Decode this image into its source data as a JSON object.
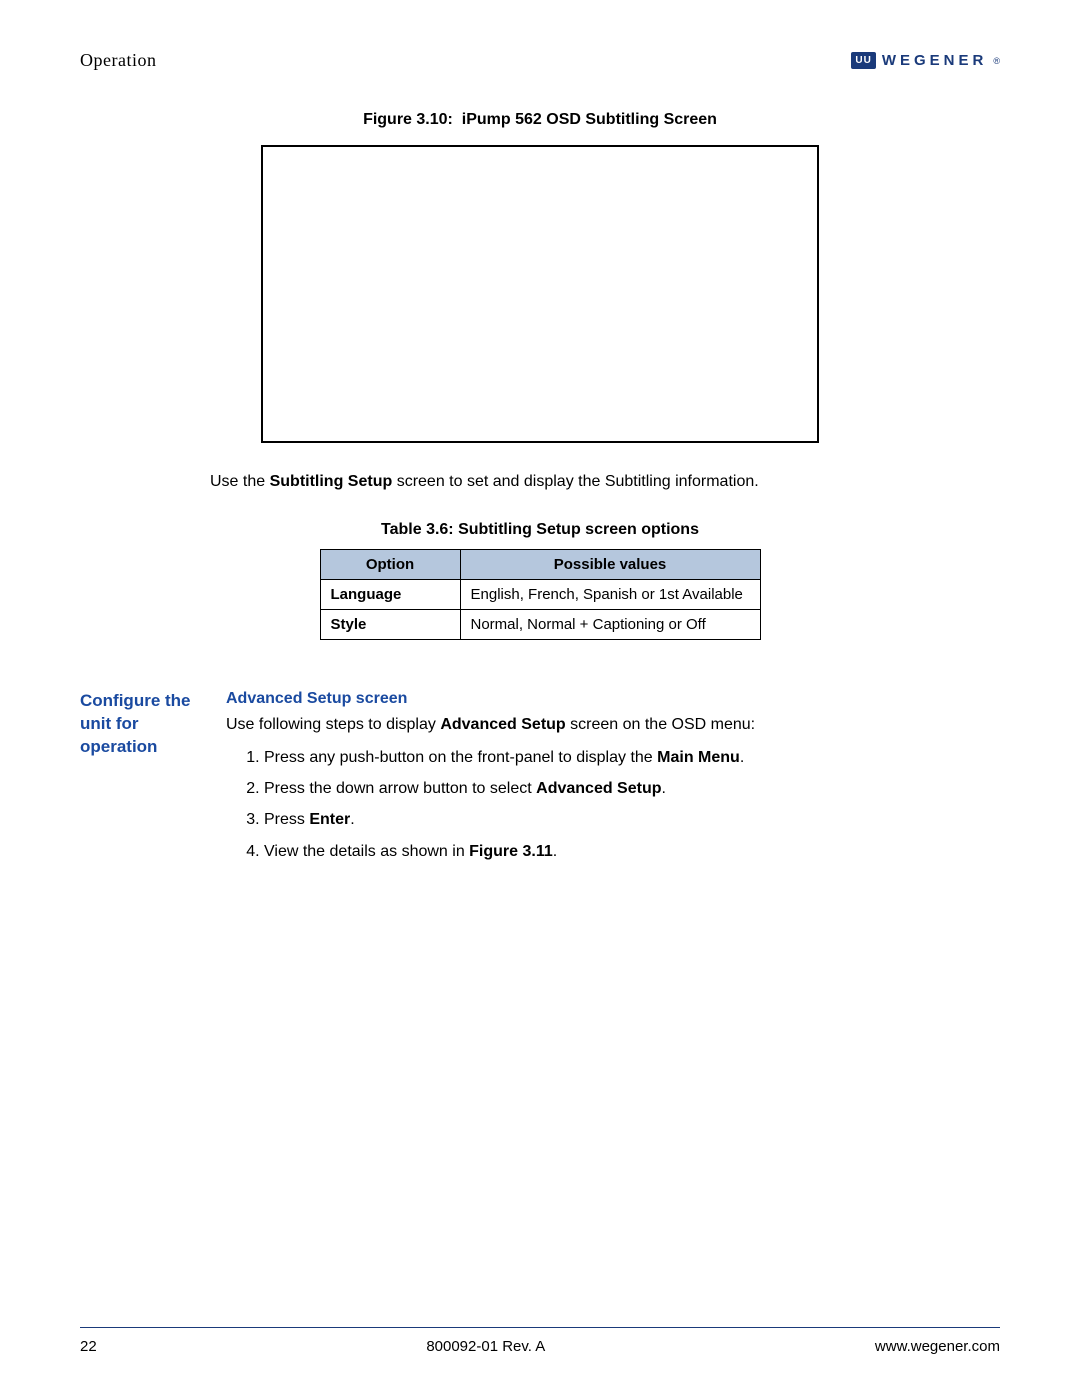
{
  "header": {
    "section": "Operation",
    "logo_badge": "UU",
    "logo_text": "WEGENER"
  },
  "figure": {
    "caption_prefix": "Figure 3.10:",
    "caption_title": "iPump 562 OSD Subtitling Screen"
  },
  "intro": {
    "pre": "Use the ",
    "bold": "Subtitling Setup",
    "post": " screen to set and display the Subtitling information."
  },
  "table": {
    "caption": "Table 3.6: Subtitling Setup screen options",
    "headers": {
      "col1": "Option",
      "col2": "Possible values"
    },
    "rows": [
      {
        "option": "Language",
        "values": "English, French, Spanish or 1st Available"
      },
      {
        "option": "Style",
        "values": "Normal, Normal + Captioning or Off"
      }
    ]
  },
  "config": {
    "side_heading": "Configure the unit for operation",
    "sub_heading": "Advanced Setup screen",
    "intro_pre": "Use following steps to display ",
    "intro_bold": "Advanced Setup",
    "intro_post": " screen on the OSD menu:",
    "steps": {
      "s1_pre": "Press any push-button on the front-panel to display the ",
      "s1_bold": "Main Menu",
      "s1_post": ".",
      "s2_pre": "Press the down arrow button to select ",
      "s2_bold": "Advanced Setup",
      "s2_post": ".",
      "s3_pre": "Press ",
      "s3_bold": "Enter",
      "s3_post": ".",
      "s4_pre": "View the details as shown in ",
      "s4_bold": "Figure 3.11",
      "s4_post": "."
    }
  },
  "footer": {
    "page": "22",
    "docref": "800092-01 Rev. A",
    "url": "www.wegener.com"
  }
}
